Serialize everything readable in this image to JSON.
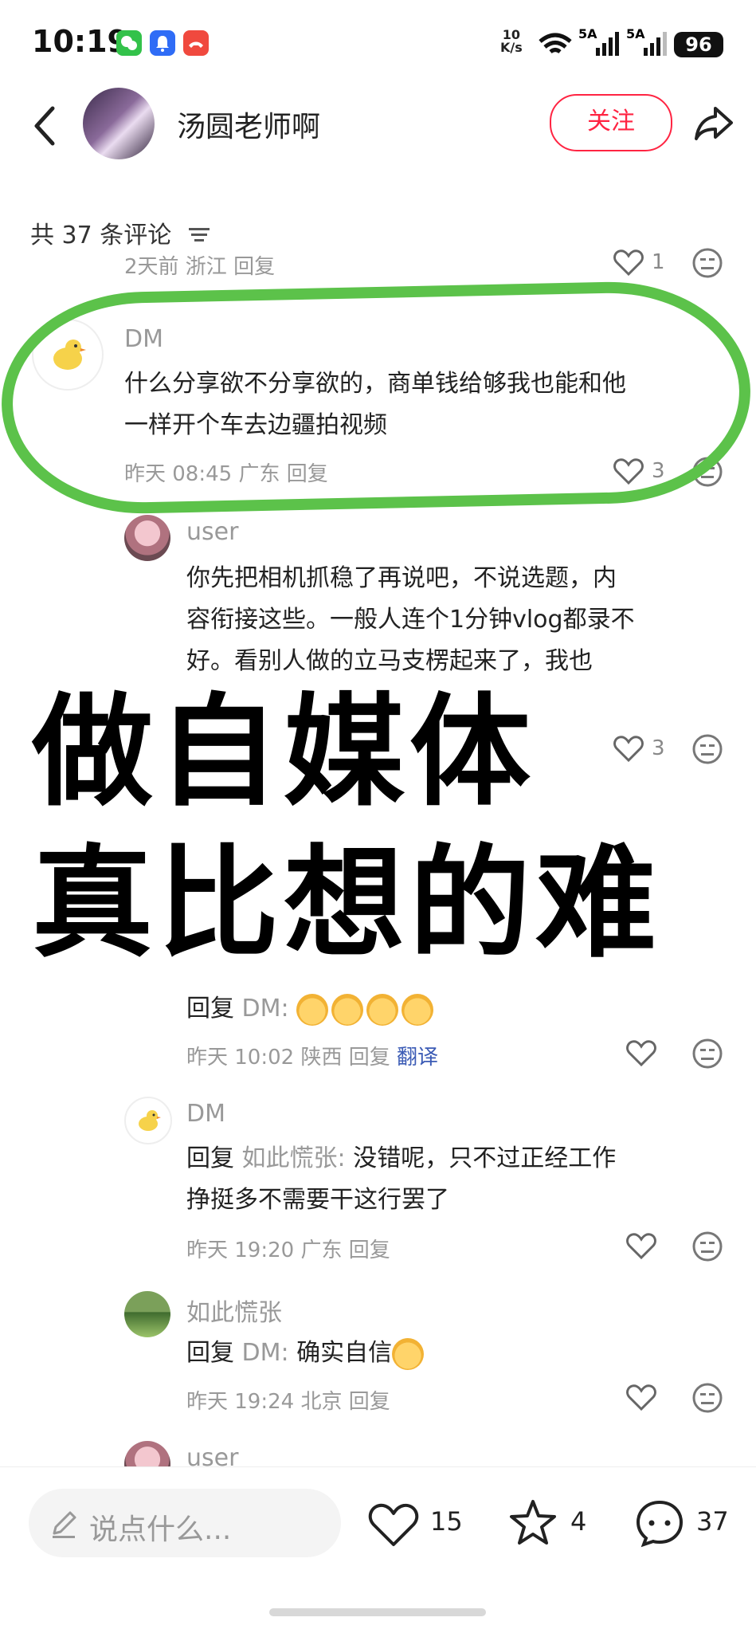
{
  "status": {
    "time": "10:19",
    "net_speed": "10\nK/s",
    "signal1": "5A",
    "signal2": "5A",
    "battery": "96",
    "wifi_label": "6"
  },
  "author": {
    "name": "汤圆老师啊",
    "follow_label": "关注"
  },
  "comments_header": {
    "title": "共 37 条评论"
  },
  "prev_comment": {
    "meta": "2天前 浙江 回复",
    "likes": "1"
  },
  "comments": [
    {
      "user": "DM",
      "text_line1": "什么分享欲不分享欲的，商单钱给够我也能和他",
      "text_line2": "一样开个车去边疆拍视频",
      "meta": "昨天 08:45 广东 回复",
      "likes": "3"
    },
    {
      "user": "user",
      "text_line1": "你先把相机抓稳了再说吧，不说选题，内",
      "text_line2": "容衔接这些。一般人连个1分钟vlog都录不",
      "text_line3": "好。看别人做的立马支楞起来了，我也",
      "likes": "3"
    }
  ],
  "overlay": {
    "line1": "做自媒体",
    "line2": "真比想的难"
  },
  "replies": [
    {
      "reply_prefix": "回复",
      "reply_to": "DM:",
      "meta": "昨天 10:02 陕西 回复",
      "translate": "翻译"
    },
    {
      "user": "DM",
      "reply_prefix": "回复",
      "reply_to": "如此慌张:",
      "text_line1": " 没错呢，只不过正经工作",
      "text_line2": "挣挺多不需要干这行罢了",
      "meta": "昨天 19:20 广东 回复"
    },
    {
      "user": "如此慌张",
      "reply_prefix": "回复",
      "reply_to": "DM:",
      "text_line1": " 确实自信",
      "meta": "昨天 19:24 北京 回复"
    },
    {
      "user": "user"
    }
  ],
  "bottom": {
    "placeholder": "说点什么...",
    "likes": "15",
    "stars": "4",
    "comments": "37"
  },
  "colors": {
    "accent": "#ff2442",
    "highlight_ring": "#5cc24a"
  }
}
